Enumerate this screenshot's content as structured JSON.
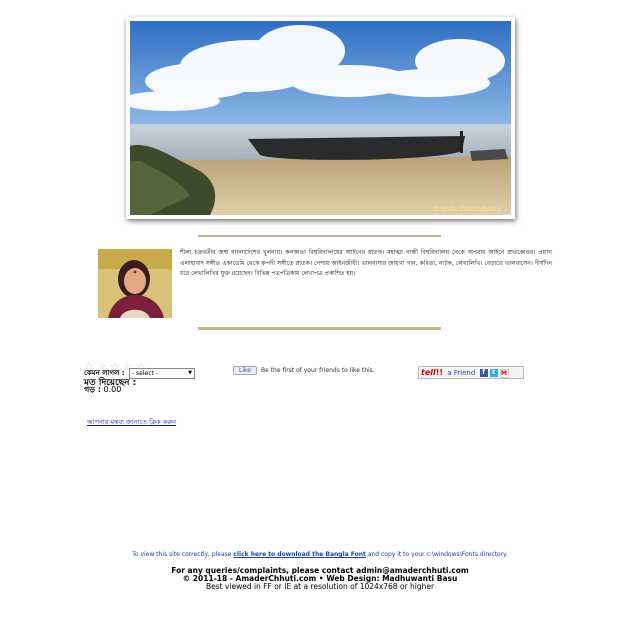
{
  "hero": {
    "signature": "© Shila Chakraborty"
  },
  "author": {
    "bio": "শীলা চক্রবর্তীর জন্ম বাংলাদেশের খুলনায়। কলকাতা বিশ্ববিদ্যালয়ের আইনের স্নাতক। মহাত্মা গান্ধী বিশ্ববিদ্যালয় থেকে অপরাধ আইনে স্নাতকোত্তর। প্রয়াগ এলাহাবাদ সঙ্গীত একাডেমি থেকে রুপদী সঙ্গীতে স্নাতক। পেশায় আইনজীবী। ভালবাসার জায়গা গান, কবিতা, নাটক, লেখালিখি। বেড়াতে ভালবাসেন। দীর্ঘদিন ধরে লেখালিখির যুক্ত রয়েছেন। বিভিন্ন পত্রপত্রিকায় লেখাপত্র প্রকাশিত হয়।"
  },
  "rating": {
    "stars": 5,
    "label": "কেমন লাগল :",
    "select_value": "- select -",
    "votes_label": "মত দিয়েছেন :",
    "average_label": "গড় :",
    "average_value": "0.00"
  },
  "social": {
    "like_label": "Like",
    "like_text": "Be the first of your friends to like this.",
    "tell_logo": "tell",
    "tell_text": "a Friend"
  },
  "comment_link": "আপনার মন্তব্য জানাতে ক্লিক করুন",
  "footer": {
    "font_note_pre": "To view this site correctly, please",
    "font_note_link": "click here to download the Bangla Font",
    "font_note_post": "and copy it to your c:\\windows\\Fonts directory.",
    "contact": "For any queries/complaints, please contact admin@amaderchhuti.com",
    "copyright": "© 2011-18 - AmaderChhuti.com • Web Design: Madhuwanti Basu",
    "best_viewed": "Best viewed in FF or IE at a resolution of 1024x768 or higher"
  },
  "colors": {
    "rule": "#c8b48e",
    "link": "#1a1aa6",
    "footer_note": "#1b3fb8"
  }
}
